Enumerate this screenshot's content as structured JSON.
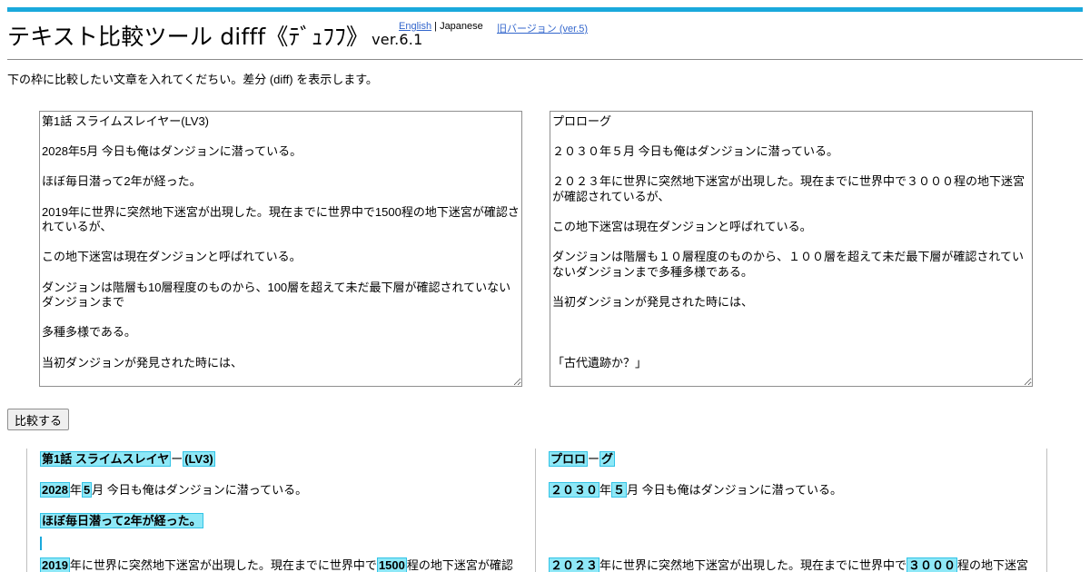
{
  "header": {
    "title": "テキスト比較ツール difff《ﾃﾞｭﾌﾌ》",
    "version": "ver.6.1",
    "lang_english": "English",
    "lang_separator": "|",
    "lang_japanese": "Japanese",
    "old_version": "旧バージョン (ver.5)"
  },
  "description": "下の枠に比較したい文章を入れてくだちい。差分 (diff) を表示します。",
  "inputs": {
    "left_text": "第1話 スライムスレイヤー(LV3)\n\n2028年5月 今日も俺はダンジョンに潜っている。\n\nほぼ毎日潜って2年が経った。\n\n2019年に世界に突然地下迷宮が出現した。現在までに世界中で1500程の地下迷宮が確認されているが、\n\nこの地下迷宮は現在ダンジョンと呼ばれている。\n\nダンジョンは階層も10層程度のものから、100層を超えて未だ最下層が確認されていないダンジョンまで\n\n多種多様である。\n\n当初ダンジョンが発見された時には、",
    "right_text": "プロローグ\n\n２０３０年５月 今日も俺はダンジョンに潜っている。\n\n２０２３年に世界に突然地下迷宮が出現した。現在までに世界中で３０００程の地下迷宮が確認されているが、\n\nこの地下迷宮は現在ダンジョンと呼ばれている。\n\nダンジョンは階層も１０層程度のものから、１００層を超えて未だ最下層が確認されていないダンジョンまで多種多様である。\n\n当初ダンジョンが発見された時には、\n\n\n\n「古代遺跡か？」"
  },
  "compare_button": "比較する",
  "result": {
    "left": {
      "line1": {
        "seg1": "第1話 スライムスレイヤ",
        "seg2": "ー",
        "seg3": "(LV3)"
      },
      "line2": {
        "seg1": "2028",
        "seg2": "年",
        "seg3": "5",
        "seg4": "月 今日も俺はダンジョンに潜っている。"
      },
      "line3": {
        "seg1": "ほぼ毎日潜って2年が経った。"
      },
      "line4": {
        "seg1": "2019",
        "seg2": "年に世界に突然地下迷宮が出現した。現在までに世界中で",
        "seg3": "1500",
        "seg4": "程の地下迷宮が確認"
      }
    },
    "right": {
      "line1": {
        "seg1": "プロロ",
        "seg2": "ー",
        "seg3": "グ"
      },
      "line2": {
        "seg1": "２０３０",
        "seg2": "年",
        "seg3": "５",
        "seg4": "月 今日も俺はダンジョンに潜っている。"
      },
      "line4": {
        "seg1": "２０２３",
        "seg2": "年に世界に突然地下迷宮が出現した。現在までに世界中で",
        "seg3": "３０００",
        "seg4": "程の地下迷宮"
      }
    }
  },
  "colors": {
    "accent": "#1aa9dc",
    "highlight": "#8ee8f7",
    "link": "#3366cc"
  }
}
